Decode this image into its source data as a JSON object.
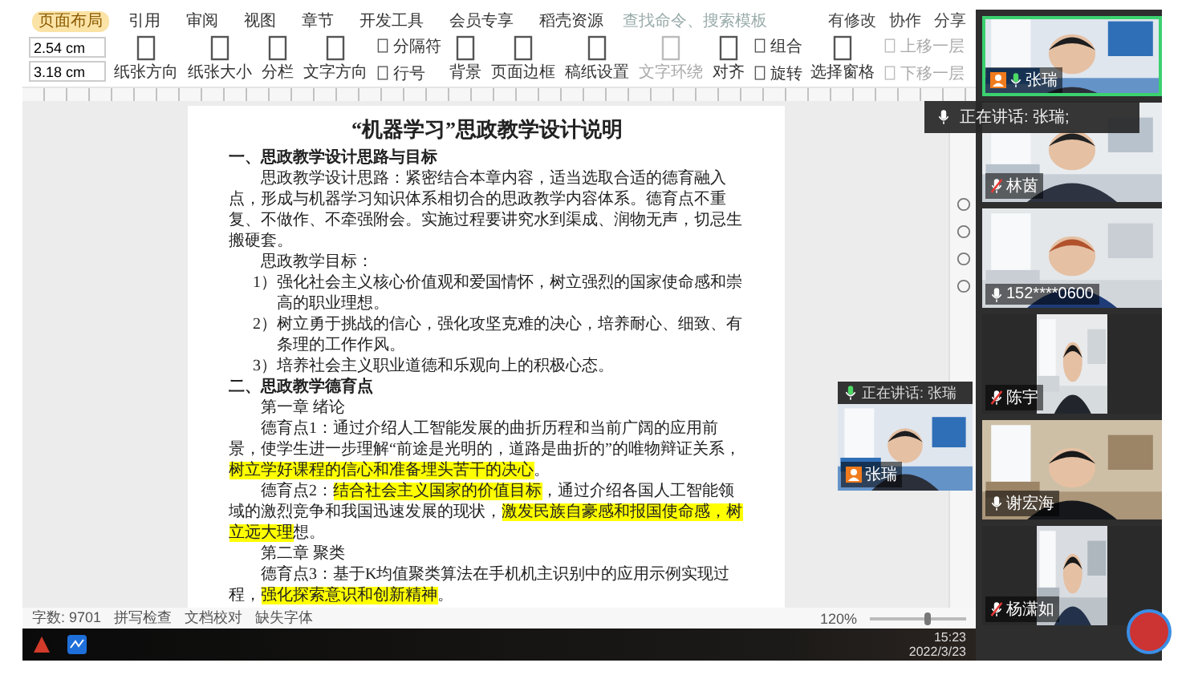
{
  "ribbon": {
    "tabs": [
      {
        "label": "页面布局",
        "selected": true
      },
      {
        "label": "引用",
        "selected": false
      },
      {
        "label": "审阅",
        "selected": false
      },
      {
        "label": "视图",
        "selected": false
      },
      {
        "label": "章节",
        "selected": false
      },
      {
        "label": "开发工具",
        "selected": false
      },
      {
        "label": "会员专享",
        "selected": false
      },
      {
        "label": "稻壳资源",
        "selected": false
      }
    ],
    "search": {
      "placeholder": "查找命令、搜索模板"
    },
    "actions": [
      "有修改",
      "协作",
      "分享"
    ],
    "margins": [
      "2.54 cm",
      "3.18 cm"
    ],
    "tools": [
      {
        "kind": "big",
        "label": "纸张方向",
        "disabled": false
      },
      {
        "kind": "big",
        "label": "纸张大小",
        "disabled": false
      },
      {
        "kind": "big",
        "label": "分栏",
        "disabled": false
      },
      {
        "kind": "big",
        "label": "文字方向",
        "disabled": false
      },
      {
        "kind": "pair",
        "labels": [
          "分隔符",
          "行号"
        ],
        "disabled": false
      },
      {
        "kind": "big",
        "label": "背景",
        "disabled": false
      },
      {
        "kind": "big",
        "label": "页面边框",
        "disabled": false
      },
      {
        "kind": "big",
        "label": "稿纸设置",
        "disabled": false
      },
      {
        "kind": "big",
        "label": "文字环绕",
        "disabled": true
      },
      {
        "kind": "big",
        "label": "对齐",
        "disabled": false
      },
      {
        "kind": "pair",
        "labels": [
          "组合",
          "旋转"
        ],
        "disabled": false
      },
      {
        "kind": "big",
        "label": "选择窗格",
        "disabled": false
      },
      {
        "kind": "pair",
        "labels": [
          "上移一层",
          "下移一层"
        ],
        "disabled": true
      }
    ]
  },
  "document": {
    "title": "“机器学习”思政教学设计说明",
    "blocks": [
      {
        "kind": "heading",
        "segments": [
          {
            "text": "一、思政教学设计思路与目标",
            "highlighted": false
          }
        ]
      },
      {
        "kind": "para",
        "segments": [
          {
            "text": "思政教学设计思路：紧密结合本章内容，适当选取合适的德育融入点，形成与机器学习知识体系相切合的思政教学内容体系。德育点不重复、不做作、不牵强附会。实施过程要讲究水到渠成、润物无声，切忌生搬硬套。",
            "highlighted": false
          }
        ]
      },
      {
        "kind": "para",
        "segments": [
          {
            "text": "思政教学目标：",
            "highlighted": false
          }
        ]
      },
      {
        "kind": "list",
        "segments": [
          {
            "text": "1）强化社会主义核心价值观和爱国情怀，树立强烈的国家使命感和崇高的职业理想。",
            "highlighted": false
          }
        ]
      },
      {
        "kind": "list",
        "segments": [
          {
            "text": "2）树立勇于挑战的信心，强化攻坚克难的决心，培养耐心、细致、有条理的工作作风。",
            "highlighted": false
          }
        ]
      },
      {
        "kind": "list",
        "segments": [
          {
            "text": "3）培养社会主义职业道德和乐观向上的积极心态。",
            "highlighted": false
          }
        ]
      },
      {
        "kind": "heading",
        "segments": [
          {
            "text": "二、思政教学德育点",
            "highlighted": false
          }
        ]
      },
      {
        "kind": "para",
        "segments": [
          {
            "text": "第一章  绪论",
            "highlighted": false
          }
        ]
      },
      {
        "kind": "para",
        "segments": [
          {
            "text": "德育点1：通过介绍人工智能发展的曲折历程和当前广阔的应用前景，使学生进一步理解“前途是光明的，道路是曲折的”的唯物辩证关系，",
            "highlighted": false
          },
          {
            "text": "树立学好课程的信心和准备埋头苦干的决心",
            "highlighted": true
          },
          {
            "text": "。",
            "highlighted": false
          }
        ]
      },
      {
        "kind": "para",
        "segments": [
          {
            "text": "德育点2：",
            "highlighted": false
          },
          {
            "text": "结合社会主义国家的价值目标",
            "highlighted": true
          },
          {
            "text": "，通过介绍各国人工智能领域的激烈竞争和我国迅速发展的现状，",
            "highlighted": false
          },
          {
            "text": "激发民族自豪感和报国使命感，树立远大理",
            "highlighted": true
          },
          {
            "text": "想。",
            "highlighted": false
          }
        ]
      },
      {
        "kind": "para",
        "segments": [
          {
            "text": "第二章  聚类",
            "highlighted": false
          }
        ]
      },
      {
        "kind": "para",
        "segments": [
          {
            "text": "德育点3：基于K均值聚类算法在手机机主识别中的应用示例实现过程，",
            "highlighted": false
          },
          {
            "text": "强化探索意识和创新精神",
            "highlighted": true
          },
          {
            "text": "。",
            "highlighted": false
          }
        ]
      }
    ]
  },
  "status_bar": {
    "word_count": "字数: 9701",
    "items": [
      "拼写检查",
      "文档校对",
      "缺失字体"
    ],
    "zoom": "120%",
    "level": 0.6
  },
  "taskbar": {
    "time": "15:23",
    "date": "2022/3/23"
  },
  "speaking_banner": {
    "text": "正在讲话: 张瑞;"
  },
  "floating_video": {
    "header": "正在讲话: 张瑞",
    "name": "张瑞"
  },
  "participants": [
    {
      "name": "张瑞",
      "kind": "full",
      "muted": false,
      "speaking": true,
      "host": true
    },
    {
      "name": "林茵",
      "kind": "full",
      "muted": true,
      "speaking": false,
      "host": false
    },
    {
      "name": "152****0600",
      "kind": "full",
      "muted": false,
      "speaking": false,
      "host": false
    },
    {
      "name": "陈宇",
      "kind": "portrait",
      "muted": true,
      "speaking": false,
      "host": false
    },
    {
      "name": "谢宏海",
      "kind": "full",
      "muted": false,
      "speaking": false,
      "host": false
    },
    {
      "name": "杨潇如",
      "kind": "portrait",
      "muted": true,
      "speaking": false,
      "host": false
    }
  ]
}
